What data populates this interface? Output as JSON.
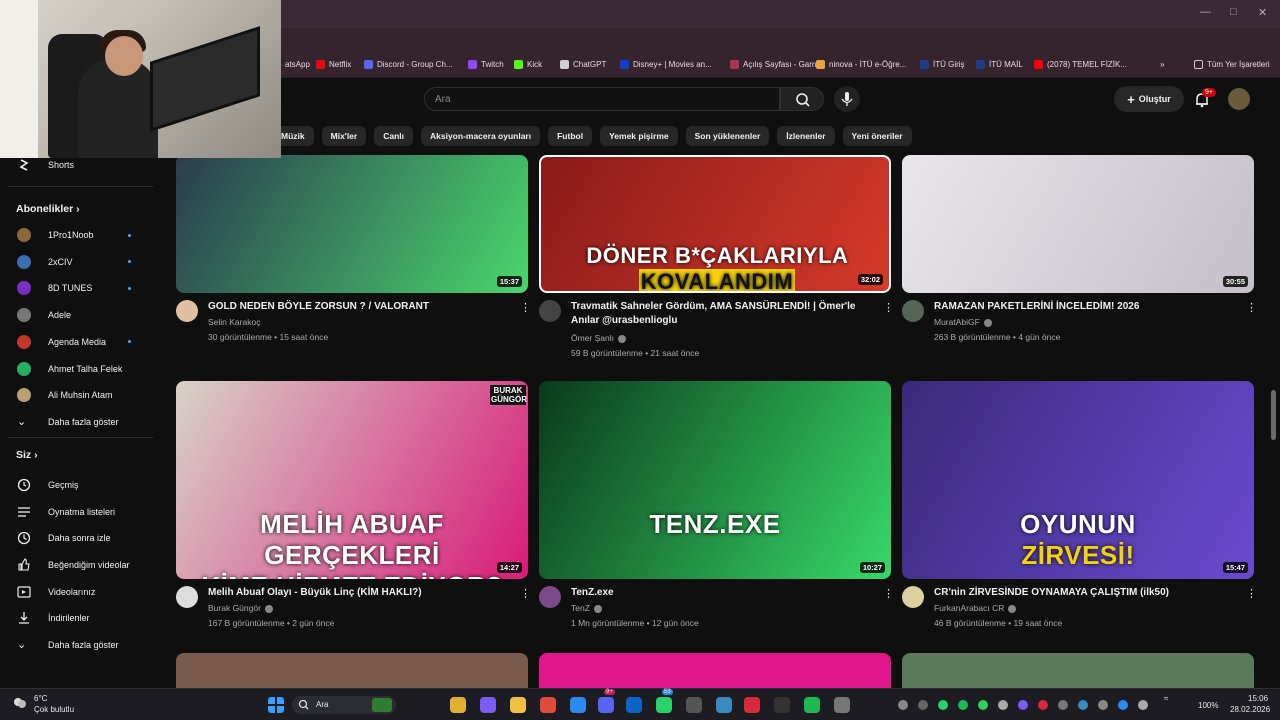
{
  "bookmarks": [
    {
      "label": "atsApp",
      "color": "#25d366"
    },
    {
      "label": "Netflix",
      "color": "#e50914"
    },
    {
      "label": "Discord - Group Ch...",
      "color": "#5865f2"
    },
    {
      "label": "Twitch",
      "color": "#9146ff"
    },
    {
      "label": "Kick",
      "color": "#53fc18"
    },
    {
      "label": "ChatGPT",
      "color": "#cfcfcf"
    },
    {
      "label": "Disney+ | Movies an...",
      "color": "#113ccf"
    },
    {
      "label": "Açılış Sayfası - Garn...",
      "color": "#aa3355"
    },
    {
      "label": "ninova - İTÜ e-Öğre...",
      "color": "#e8a33a"
    },
    {
      "label": "İTÜ Giriş",
      "color": "#1f3c88"
    },
    {
      "label": "İTÜ MAİL",
      "color": "#1f3c88"
    },
    {
      "label": "(2078) TEMEL FİZİK...",
      "color": "#ff0000"
    }
  ],
  "bookmarks_overflow": "»",
  "all_bookmarks": "Tüm Yer İşaretleri",
  "header": {
    "search_placeholder": "Ara",
    "create_label": "Oluştur",
    "notif_count": "9+"
  },
  "chips": [
    "Müzik",
    "Mix'ler",
    "Canlı",
    "Aksiyon-macera oyunları",
    "Futbol",
    "Yemek pişirme",
    "Son yüklenenler",
    "İzlenenler",
    "Yeni öneriler"
  ],
  "sidebar": {
    "shorts": "Shorts",
    "subscriptions_title": "Abonelikler",
    "channels": [
      {
        "name": "1Pro1Noob",
        "color": "#8a6a3a",
        "dot": true
      },
      {
        "name": "2xCIV",
        "color": "#3b6fb0",
        "dot": true
      },
      {
        "name": "8D TUNES",
        "color": "#7b2fbe",
        "dot": true
      },
      {
        "name": "Adele",
        "color": "#777777",
        "dot": false
      },
      {
        "name": "Agenda Media",
        "color": "#c0392b",
        "dot": true
      },
      {
        "name": "Ahmet Talha Felek",
        "color": "#27ae60",
        "dot": false
      },
      {
        "name": "Ali Muhsin Atam",
        "color": "#b8a070",
        "dot": false
      }
    ],
    "show_more": "Daha fazla göster",
    "you_title": "Siz",
    "you_items": [
      {
        "label": "Geçmiş",
        "icon": "history-icon"
      },
      {
        "label": "Oynatma listeleri",
        "icon": "playlist-icon"
      },
      {
        "label": "Daha sonra izle",
        "icon": "clock-icon"
      },
      {
        "label": "Beğendiğim videolar",
        "icon": "thumb-up-icon"
      },
      {
        "label": "Videolarınız",
        "icon": "video-icon"
      },
      {
        "label": "İndirilenler",
        "icon": "download-icon"
      }
    ],
    "show_more2": "Daha fazla göster"
  },
  "videos": [
    {
      "title": "GOLD NEDEN BÖYLE ZORSUN ? / VALORANT",
      "channel": "Selin Karakoç",
      "verified": false,
      "meta": "30 görüntülenme • 15 saat önce",
      "duration": "15:37",
      "thumb_colors": [
        "#2a3b4f",
        "#4ad66d"
      ],
      "overlay": "",
      "avatar": "#e0c0a0"
    },
    {
      "title": "Travmatik Sahneler Gördüm, AMA SANSÜRLENDİ! | Ömer'le Anılar @urasbenlioglu",
      "channel": "Ömer Şanlı",
      "verified": true,
      "meta": "59 B görüntülenme • 21 saat önce",
      "duration": "32:02",
      "thumb_colors": [
        "#8a1a1a",
        "#d63a2a"
      ],
      "overlay": "DÖNER B*ÇAKLARIYLA",
      "overlay2": "KOVALANDIM",
      "avatar": "#444444"
    },
    {
      "title": "RAMAZAN PAKETLERİNİ İNCELEDİM! 2026",
      "channel": "MuratAbiGF",
      "verified": true,
      "meta": "263 B görüntülenme • 4 gün önce",
      "duration": "30:55",
      "thumb_colors": [
        "#e8e6ea",
        "#c4bfc8"
      ],
      "overlay": "",
      "avatar": "#556655"
    },
    {
      "title": "Melih Abuaf Olayı - Büyük Linç (KİM HAKLI?)",
      "channel": "Burak Güngör",
      "verified": true,
      "meta": "167 B görüntülenme • 2 gün önce",
      "duration": "14:27",
      "thumb_colors": [
        "#d8d2c8",
        "#d81b7a"
      ],
      "overlay": "MELİH ABUAF GERÇEKLERİ",
      "overlay2": "KİME HİZMET EDİYOR?",
      "corner": "BURAK GÜNGÖR",
      "avatar": "#dddddd"
    },
    {
      "title": "TenZ.exe",
      "channel": "TenZ",
      "verified": true,
      "meta": "1 Mn görüntülenme • 12 gün önce",
      "duration": "10:27",
      "thumb_colors": [
        "#0a3a1a",
        "#38d86a"
      ],
      "overlay": "TENZ.EXE",
      "avatar": "#7a4a8a"
    },
    {
      "title": "CR'nin ZİRVESİNDE OYNAMAYA ÇALIŞTIM (ilk50)",
      "channel": "FurkanArabacı CR",
      "verified": true,
      "meta": "46 B görüntülenme • 19 saat önce",
      "duration": "15:47",
      "thumb_colors": [
        "#3a2a7a",
        "#6a4ad0"
      ],
      "overlay": "OYUNUN",
      "overlay2": "ZİRVESİ!",
      "avatar": "#ddd0a0"
    }
  ],
  "bottom_row_colors": [
    "#7a5a4a",
    "#e0178a",
    "#5a7a5a"
  ],
  "taskbar": {
    "weather_temp": "6°C",
    "weather_desc": "Çok bulutlu",
    "search": "Ara",
    "battery": "100%",
    "time": "15:06",
    "date": "28.02.2026",
    "badge_a": "9+",
    "badge_b": "53"
  }
}
